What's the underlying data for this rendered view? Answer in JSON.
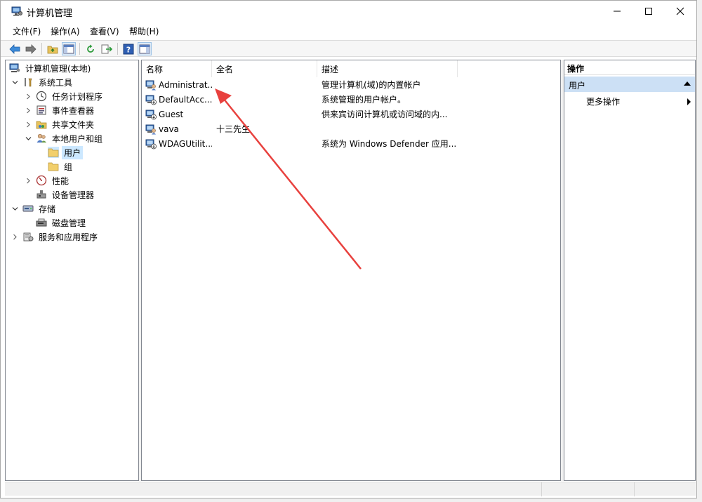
{
  "window": {
    "title": "计算机管理"
  },
  "menu": [
    {
      "label": "文件(F)"
    },
    {
      "label": "操作(A)"
    },
    {
      "label": "查看(V)"
    },
    {
      "label": "帮助(H)"
    }
  ],
  "tree": {
    "root": "计算机管理(本地)",
    "system_tools": "系统工具",
    "task_scheduler": "任务计划程序",
    "event_viewer": "事件查看器",
    "shared_folders": "共享文件夹",
    "local_users_groups": "本地用户和组",
    "users": "用户",
    "groups": "组",
    "performance": "性能",
    "device_manager": "设备管理器",
    "storage": "存储",
    "disk_management": "磁盘管理",
    "services_apps": "服务和应用程序"
  },
  "list": {
    "columns": [
      "名称",
      "全名",
      "描述"
    ],
    "rows": [
      {
        "name": "Administrat...",
        "fullname": "",
        "desc": "管理计算机(域)的内置帐户"
      },
      {
        "name": "DefaultAcc...",
        "fullname": "",
        "desc": "系统管理的用户帐户。"
      },
      {
        "name": "Guest",
        "fullname": "",
        "desc": "供来宾访问计算机或访问域的内..."
      },
      {
        "name": "vava",
        "fullname": "十三先生",
        "desc": ""
      },
      {
        "name": "WDAGUtilit...",
        "fullname": "",
        "desc": "系统为 Windows Defender 应用..."
      }
    ]
  },
  "actions": {
    "header": "操作",
    "section": "用户",
    "more": "更多操作"
  },
  "colors": {
    "selection": "#cce8ff",
    "action_section": "#cce0f5",
    "annotation_arrow": "#e8413e"
  }
}
